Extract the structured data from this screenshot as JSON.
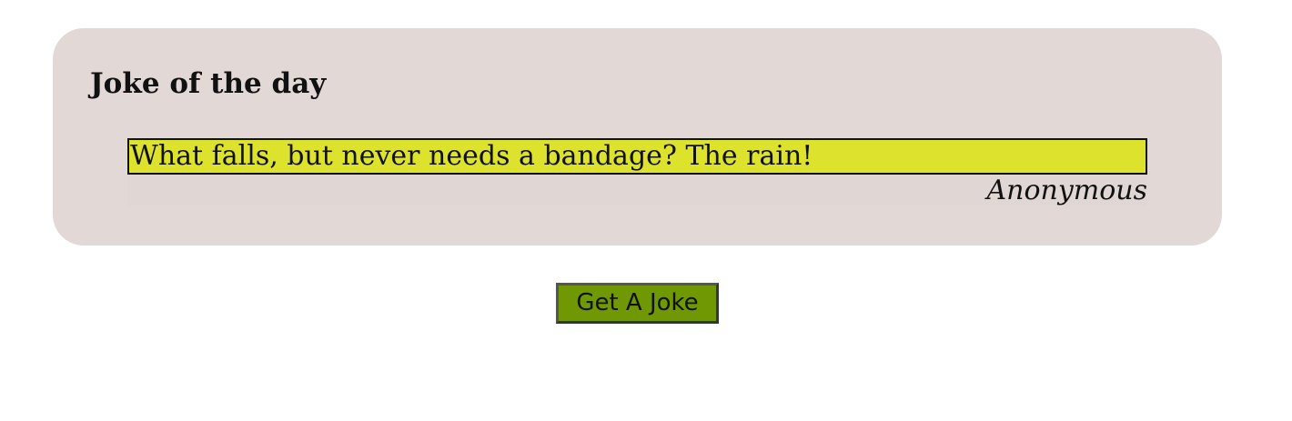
{
  "card": {
    "title": "Joke of the day",
    "background": "#e2d9d6"
  },
  "joke": {
    "text": "What falls, but never needs a bandage? The rain!",
    "author": "Anonymous",
    "highlight_color": "#dde32c"
  },
  "button": {
    "label": "Get A Joke",
    "color": "#709803"
  }
}
